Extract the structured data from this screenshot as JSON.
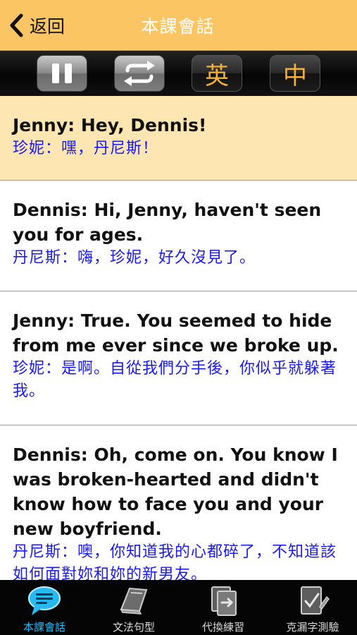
{
  "navbar": {
    "back_label": "返回",
    "title": "本課會話"
  },
  "toolbar": {
    "pause_icon": "pause-icon",
    "repeat_icon": "repeat-icon",
    "english_label": "英",
    "chinese_label": "中",
    "accent_color": "#f3b03c"
  },
  "dialogue": [
    {
      "en": "Jenny: Hey, Dennis!",
      "zh": "珍妮：嘿，丹尼斯！"
    },
    {
      "en": "Dennis: Hi, Jenny, haven't seen you for ages.",
      "zh": "丹尼斯：嗨，珍妮，好久沒見了。"
    },
    {
      "en": "Jenny: True. You seemed to hide from me ever since we broke up.",
      "zh": "珍妮：是啊。自從我們分手後，你似乎就躲著我。"
    },
    {
      "en": "Dennis: Oh, come on. You know I was broken-hearted and didn't know how to face you and your new boyfriend.",
      "zh": "丹尼斯：噢，你知道我的心都碎了，不知道該如何面對妳和妳的新男友。"
    }
  ],
  "tabs": [
    {
      "label": "本課會話",
      "icon": "chat-bubble-icon"
    },
    {
      "label": "文法句型",
      "icon": "book-icon"
    },
    {
      "label": "代換練習",
      "icon": "document-swap-icon"
    },
    {
      "label": "克漏字測驗",
      "icon": "edit-document-icon"
    }
  ],
  "colors": {
    "navbar": "#fcc564",
    "active_row": "#fde6b1",
    "chinese_text": "#1a1af0",
    "tab_selected": "#27b9f2"
  }
}
